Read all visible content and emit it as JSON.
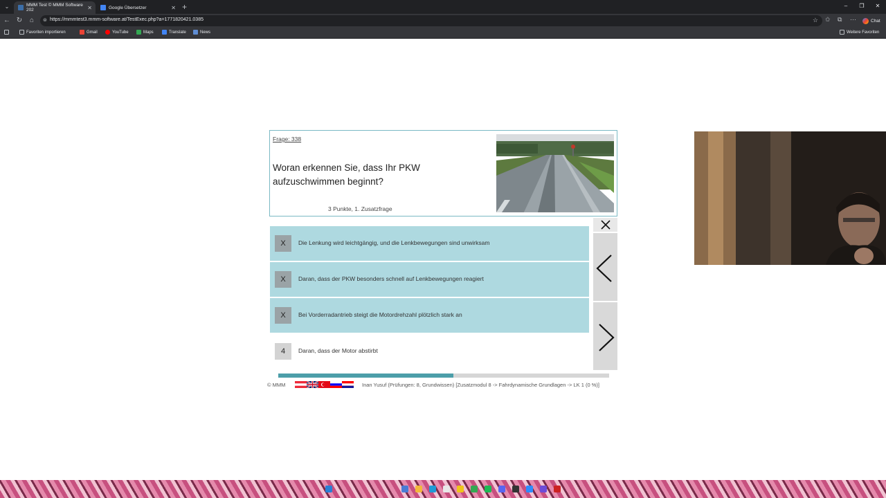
{
  "browser": {
    "tabs": [
      {
        "title": "MMM Test © MMM Software 202",
        "active": true
      },
      {
        "title": "Google Übersetzer",
        "active": false
      }
    ],
    "url": "https://mmmtest3.mmm-software.at/TestExec.php?a=1771820421.0385",
    "chat_label": "Chat",
    "bookmarks": [
      "Favoriten importieren",
      "Gmail",
      "YouTube",
      "Maps",
      "Translate",
      "News"
    ],
    "other_favorites": "Weitere Favoriten"
  },
  "question": {
    "number": "Frage: 338",
    "text": "Woran erkennen Sie, dass Ihr PKW aufzuschwimmen beginnt?",
    "points": "3 Punkte, 1. Zusatzfrage"
  },
  "answers": [
    {
      "mark": "X",
      "text": "Die Lenkung wird leichtgängig, und die Lenkbewegungen sind unwirksam",
      "selected": true
    },
    {
      "mark": "X",
      "text": "Daran, dass der PKW besonders schnell auf Lenkbewegungen reagiert",
      "selected": true
    },
    {
      "mark": "X",
      "text": "Bei Vorderradantrieb steigt die Motordrehzahl plötzlich stark an",
      "selected": true
    },
    {
      "mark": "4",
      "text": "Daran, dass der Motor abstirbt",
      "selected": false
    }
  ],
  "progress": {
    "fraction": 0.53
  },
  "footer": {
    "copyright": "© MMM",
    "info": "Inan Yusuf (Prüfungen: 8, Grundwissen) [Zusatzmodul 8 -> Fahrdynamische Grundlagen -> LK 1 (0 %)]"
  },
  "colors": {
    "answer_selected": "#aed9e0",
    "progress_fill": "#4c9ea9",
    "question_border": "#7ab9c4"
  }
}
